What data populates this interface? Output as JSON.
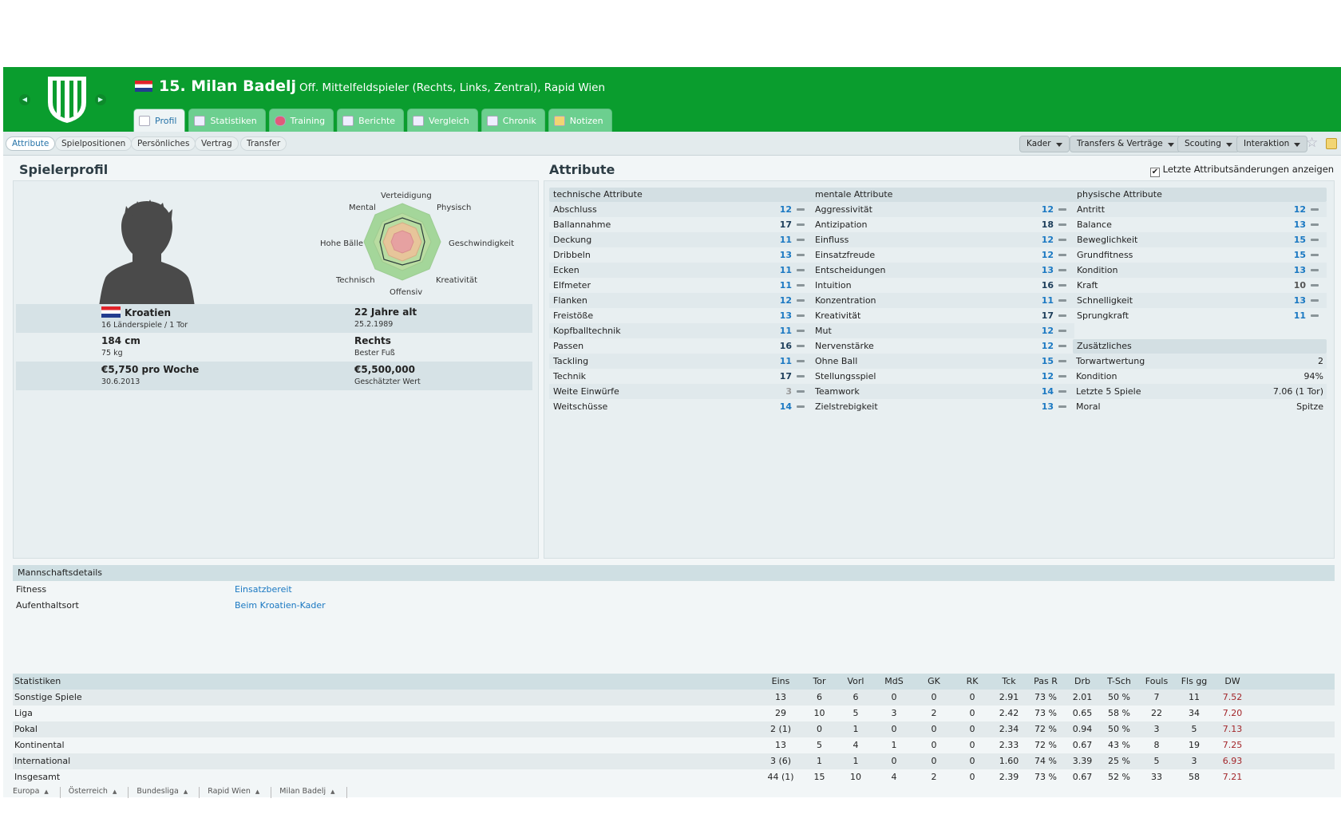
{
  "header": {
    "number_name": "15. Milan Badelj",
    "subtitle": "Off. Mittelfeldspieler (Rechts, Links, Zentral), Rapid Wien"
  },
  "tabs": [
    {
      "label": "Profil"
    },
    {
      "label": "Statistiken"
    },
    {
      "label": "Training"
    },
    {
      "label": "Berichte"
    },
    {
      "label": "Vergleich"
    },
    {
      "label": "Chronik"
    },
    {
      "label": "Notizen"
    }
  ],
  "subtabs": [
    "Attribute",
    "Spielpositionen",
    "Persönliches",
    "Vertrag",
    "Transfer"
  ],
  "menus": [
    "Kader",
    "Transfers & Verträge",
    "Scouting",
    "Interaktion"
  ],
  "profile": {
    "title": "Spielerprofil",
    "radar_labels": [
      "Verteidigung",
      "Physisch",
      "Geschwindigkeit",
      "Kreativität",
      "Offensiv",
      "Technisch",
      "Hohe Bälle",
      "Mental"
    ],
    "nation": "Kroatien",
    "caps": "16 Länderspiele / 1 Tor",
    "age": "22 Jahre alt",
    "dob": "25.2.1989",
    "height": "184 cm",
    "weight": "75 kg",
    "foot": "Rechts",
    "foot_label": "Bester Fuß",
    "wage": "€5,750 pro Woche",
    "contract": "30.6.2013",
    "value": "€5,500,000",
    "value_label": "Geschätzter Wert"
  },
  "attributes": {
    "title": "Attribute",
    "checkbox_label": "Letzte Attributsänderungen anzeigen",
    "technical": {
      "title": "technische Attribute",
      "items": [
        [
          "Abschluss",
          "12"
        ],
        [
          "Ballannahme",
          "17"
        ],
        [
          "Deckung",
          "11"
        ],
        [
          "Dribbeln",
          "13"
        ],
        [
          "Ecken",
          "11"
        ],
        [
          "Elfmeter",
          "11"
        ],
        [
          "Flanken",
          "12"
        ],
        [
          "Freistöße",
          "13"
        ],
        [
          "Kopfballtechnik",
          "11"
        ],
        [
          "Passen",
          "16"
        ],
        [
          "Tackling",
          "11"
        ],
        [
          "Technik",
          "17"
        ],
        [
          "Weite Einwürfe",
          "3"
        ],
        [
          "Weitschüsse",
          "14"
        ]
      ]
    },
    "mental": {
      "title": "mentale Attribute",
      "items": [
        [
          "Aggressivität",
          "12"
        ],
        [
          "Antizipation",
          "18"
        ],
        [
          "Einfluss",
          "12"
        ],
        [
          "Einsatzfreude",
          "12"
        ],
        [
          "Entscheidungen",
          "13"
        ],
        [
          "Intuition",
          "16"
        ],
        [
          "Konzentration",
          "11"
        ],
        [
          "Kreativität",
          "17"
        ],
        [
          "Mut",
          "12"
        ],
        [
          "Nervenstärke",
          "12"
        ],
        [
          "Ohne Ball",
          "15"
        ],
        [
          "Stellungsspiel",
          "12"
        ],
        [
          "Teamwork",
          "14"
        ],
        [
          "Zielstrebigkeit",
          "13"
        ]
      ]
    },
    "physical": {
      "title": "physische Attribute",
      "items": [
        [
          "Antritt",
          "12"
        ],
        [
          "Balance",
          "13"
        ],
        [
          "Beweglichkeit",
          "15"
        ],
        [
          "Grundfitness",
          "15"
        ],
        [
          "Kondition",
          "13"
        ],
        [
          "Kraft",
          "10"
        ],
        [
          "Schnelligkeit",
          "13"
        ],
        [
          "Sprungkraft",
          "11"
        ]
      ]
    },
    "extra": {
      "title": "Zusätzliches",
      "items": [
        [
          "Torwartwertung",
          "2"
        ],
        [
          "Kondition",
          "94%"
        ],
        [
          "Letzte 5 Spiele",
          "7.06 (1 Tor)"
        ],
        [
          "Moral",
          "Spitze"
        ]
      ]
    }
  },
  "team": {
    "title": "Mannschaftsdetails",
    "rows": [
      [
        "Fitness",
        "Einsatzbereit"
      ],
      [
        "Aufenthaltsort",
        "Beim Kroatien-Kader"
      ]
    ]
  },
  "stats": {
    "headers": [
      "Statistiken",
      "Eins",
      "Tor",
      "Vorl",
      "MdS",
      "GK",
      "RK",
      "Tck",
      "Pas R",
      "Drb",
      "T-Sch",
      "Fouls",
      "Fls gg",
      "DW"
    ],
    "rows": [
      [
        "Sonstige Spiele",
        "13",
        "6",
        "6",
        "0",
        "0",
        "0",
        "2.91",
        "73 %",
        "2.01",
        "50 %",
        "7",
        "11",
        "7.52"
      ],
      [
        "Liga",
        "29",
        "10",
        "5",
        "3",
        "2",
        "0",
        "2.42",
        "73 %",
        "0.65",
        "58 %",
        "22",
        "34",
        "7.20"
      ],
      [
        "Pokal",
        "2 (1)",
        "0",
        "1",
        "0",
        "0",
        "0",
        "2.34",
        "72 %",
        "0.94",
        "50 %",
        "3",
        "5",
        "7.13"
      ],
      [
        "Kontinental",
        "13",
        "5",
        "4",
        "1",
        "0",
        "0",
        "2.33",
        "72 %",
        "0.67",
        "43 %",
        "8",
        "19",
        "7.25"
      ],
      [
        "International",
        "3 (6)",
        "1",
        "1",
        "0",
        "0",
        "0",
        "1.60",
        "74 %",
        "3.39",
        "25 %",
        "5",
        "3",
        "6.93"
      ],
      [
        "Insgesamt",
        "44 (1)",
        "15",
        "10",
        "4",
        "2",
        "0",
        "2.39",
        "73 %",
        "0.67",
        "52 %",
        "33",
        "58",
        "7.21"
      ]
    ]
  },
  "breadcrumb": [
    "Europa",
    "Österreich",
    "Bundesliga",
    "Rapid Wien",
    "Milan Badelj"
  ]
}
